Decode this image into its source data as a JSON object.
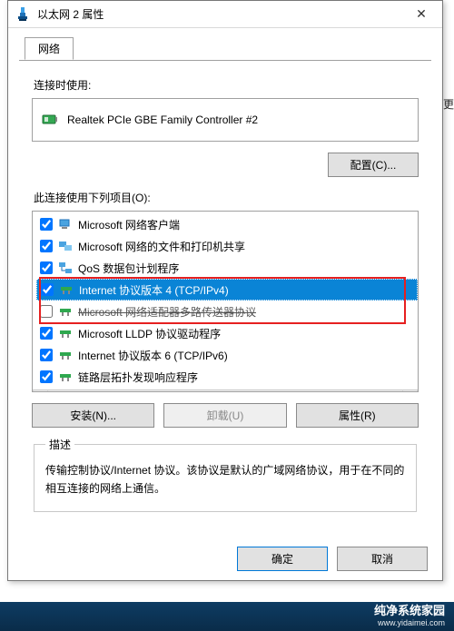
{
  "window": {
    "title": "以太网 2 属性",
    "close_label": "✕"
  },
  "tab": {
    "label": "网络"
  },
  "section": {
    "connect_using": "连接时使用:",
    "adapter": "Realtek PCIe GBE Family Controller #2",
    "items_label": "此连接使用下列项目(O):"
  },
  "buttons": {
    "configure": "配置(C)...",
    "install": "安装(N)...",
    "uninstall": "卸载(U)",
    "properties": "属性(R)",
    "ok": "确定",
    "cancel": "取消"
  },
  "items": [
    {
      "checked": true,
      "icon": "client",
      "label": "Microsoft 网络客户端"
    },
    {
      "checked": true,
      "icon": "share",
      "label": "Microsoft 网络的文件和打印机共享"
    },
    {
      "checked": true,
      "icon": "qos",
      "label": "QoS 数据包计划程序"
    },
    {
      "checked": true,
      "icon": "proto",
      "label": "Internet 协议版本 4 (TCP/IPv4)",
      "selected": true
    },
    {
      "checked": false,
      "icon": "proto",
      "label": "Microsoft 网络适配器多路传送器协议",
      "strike": true
    },
    {
      "checked": true,
      "icon": "proto",
      "label": "Microsoft LLDP 协议驱动程序"
    },
    {
      "checked": true,
      "icon": "proto",
      "label": "Internet 协议版本 6 (TCP/IPv6)"
    },
    {
      "checked": true,
      "icon": "proto",
      "label": "链路层拓扑发现响应程序"
    }
  ],
  "desc": {
    "legend": "描述",
    "text": "传输控制协议/Internet 协议。该协议是默认的广域网络协议，用于在不同的相互连接的网络上通信。"
  },
  "side_char": "更",
  "watermark": {
    "line1": "纯净系统家园",
    "line2": "www.yidaimei.com"
  }
}
